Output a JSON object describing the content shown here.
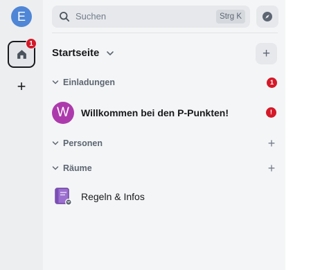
{
  "rail": {
    "account_initial": "E",
    "home_badge_count": "1",
    "add_space_glyph": "+",
    "icons": [
      "home-icon",
      "plus-icon"
    ]
  },
  "search": {
    "placeholder": "Suchen",
    "shortcut": "Strg K",
    "icons": [
      "search-icon",
      "compass-icon"
    ]
  },
  "home": {
    "title": "Startseite",
    "add_glyph": "+"
  },
  "sections": {
    "invites": {
      "label": "Einladungen",
      "count": "1"
    },
    "people": {
      "label": "Personen",
      "add_glyph": "+"
    },
    "rooms": {
      "label": "Räume",
      "add_glyph": "+"
    }
  },
  "invite": {
    "avatar_initial": "W",
    "name": "Willkommen bei den P-Punkten!",
    "alert": "!"
  },
  "room": {
    "name": "Regeln & Infos",
    "icon": "book-icon"
  },
  "colors": {
    "accent_blue": "#4f86d6",
    "badge_red": "#d51928",
    "invite_avatar": "#ad3aac",
    "room_icon": "#9b6fcf"
  }
}
